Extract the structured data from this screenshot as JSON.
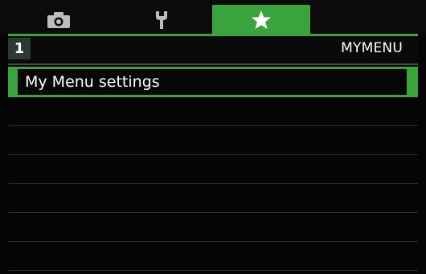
{
  "tabs": [
    {
      "icon": "camera-icon",
      "active": false
    },
    {
      "icon": "wrench-icon",
      "active": false
    },
    {
      "icon": "star-icon",
      "active": true
    }
  ],
  "header": {
    "page_number": "1",
    "title": "MYMENU"
  },
  "menu_items": [
    {
      "label": "My Menu settings",
      "selected": true
    }
  ],
  "colors": {
    "accent": "#3aa33d",
    "background": "#050505",
    "page_badge": "#2b3b31"
  }
}
